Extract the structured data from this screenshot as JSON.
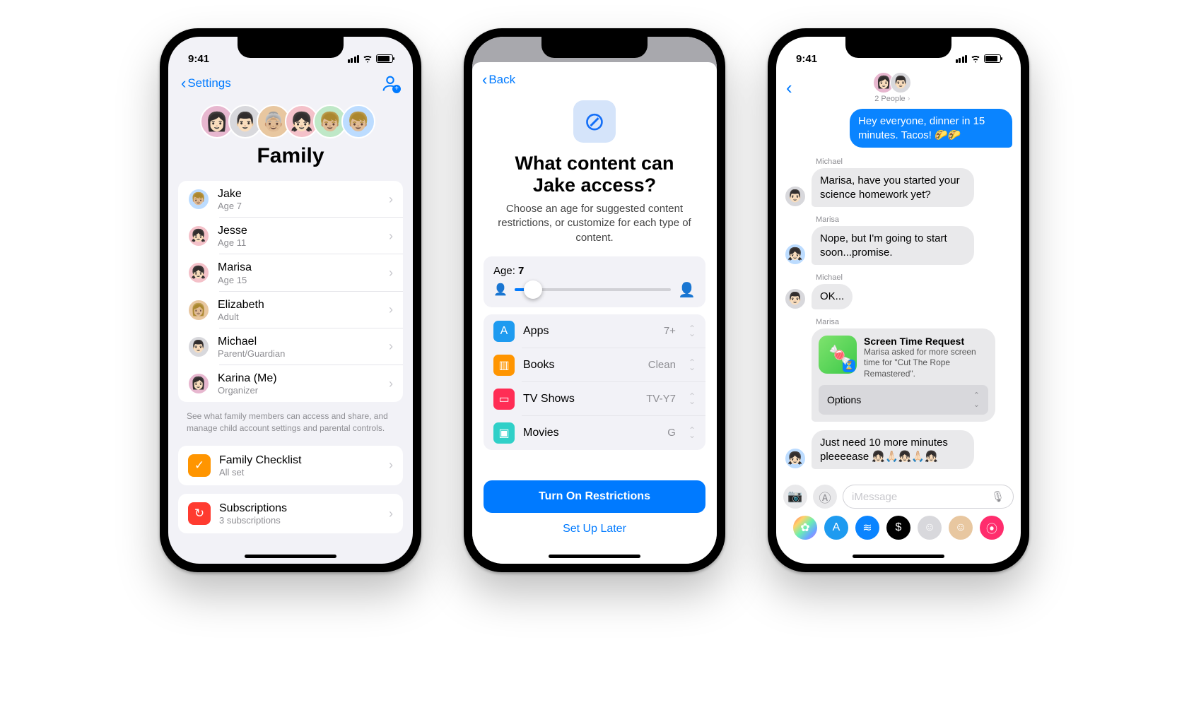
{
  "status_time": "9:41",
  "colors": {
    "accent": "#007aff",
    "outgoing": "#0a84ff",
    "gray_bg": "#f2f2f7",
    "bubble_in": "#e9e9eb"
  },
  "phone1": {
    "back_label": "Settings",
    "title": "Family",
    "avatars": [
      {
        "bg": "#e7b7cf"
      },
      {
        "bg": "#d8d8dc"
      },
      {
        "bg": "#e8c7a0"
      },
      {
        "bg": "#f4c1c9"
      },
      {
        "bg": "#bfe8c7"
      },
      {
        "bg": "#bcdcff"
      }
    ],
    "members": [
      {
        "name": "Jake",
        "sub": "Age 7",
        "bg": "#bcdcff"
      },
      {
        "name": "Jesse",
        "sub": "Age 11",
        "bg": "#f4c1c9"
      },
      {
        "name": "Marisa",
        "sub": "Age 15",
        "bg": "#f4c1c9"
      },
      {
        "name": "Elizabeth",
        "sub": "Adult",
        "bg": "#e8c7a0"
      },
      {
        "name": "Michael",
        "sub": "Parent/Guardian",
        "bg": "#d8d8dc"
      },
      {
        "name": "Karina (Me)",
        "sub": "Organizer",
        "bg": "#e7b7cf"
      }
    ],
    "hint": "See what family members can access and share, and manage child account settings and parental controls.",
    "checklist": {
      "title": "Family Checklist",
      "sub": "All set",
      "icon_bg": "#ff9500",
      "icon": "✓"
    },
    "subscriptions": {
      "title": "Subscriptions",
      "sub": "3 subscriptions",
      "icon_bg": "#ff3b30",
      "icon": "↻"
    }
  },
  "phone2": {
    "back_label": "Back",
    "title": "What content can Jake access?",
    "subtitle": "Choose an age for suggested content restrictions, or customize for each type of content.",
    "age_label": "Age:",
    "age_value": "7",
    "categories": [
      {
        "label": "Apps",
        "value": "7+",
        "bg": "#1e9bf0",
        "icon": "A"
      },
      {
        "label": "Books",
        "value": "Clean",
        "bg": "#ff9500",
        "icon": "▥"
      },
      {
        "label": "TV Shows",
        "value": "TV-Y7",
        "bg": "#ff2d55",
        "icon": "▭"
      },
      {
        "label": "Movies",
        "value": "G",
        "bg": "#30d0c8",
        "icon": "▣"
      }
    ],
    "primary": "Turn On Restrictions",
    "secondary": "Set Up Later"
  },
  "phone3": {
    "header_sub": "2 People",
    "outgoing": "Hey everyone, dinner in 15 minutes. Tacos! 🌮🌮",
    "messages": [
      {
        "sender": "Michael",
        "text": "Marisa, have you started your science homework yet?",
        "bg": "#d8d8dc",
        "show_avatar": true
      },
      {
        "sender": "Marisa",
        "text": "Nope, but I'm going to start soon...promise.",
        "bg": "#bcdcff",
        "show_avatar": true
      },
      {
        "sender": "Michael",
        "text": "OK...",
        "bg": "#d8d8dc",
        "show_avatar": true
      }
    ],
    "request": {
      "sender": "Marisa",
      "title": "Screen Time Request",
      "body": "Marisa asked for more screen time for \"Cut The Rope Remastered\".",
      "options_label": "Options"
    },
    "follow_up": {
      "sender": "Marisa",
      "text": "Just need 10 more minutes pleeeease 👧🏻🙏🏻👧🏻🙏🏻👧🏻",
      "bg": "#bcdcff"
    },
    "composer_placeholder": "iMessage",
    "tray": [
      {
        "name": "photos-icon",
        "bg": "linear-gradient(135deg,#ff6a6a,#ffd36a,#6af0b0,#6aa9ff,#c36aff)",
        "glyph": "✿"
      },
      {
        "name": "appstore-icon",
        "bg": "#1e9bf0",
        "glyph": "A"
      },
      {
        "name": "audio-icon",
        "bg": "#0a84ff",
        "glyph": "≋"
      },
      {
        "name": "cash-icon",
        "bg": "#000",
        "glyph": "$"
      },
      {
        "name": "memoji-icon",
        "bg": "#d8d8dc",
        "glyph": "☺"
      },
      {
        "name": "memoji2-icon",
        "bg": "#e8c7a0",
        "glyph": "☺"
      },
      {
        "name": "search-icon",
        "bg": "#ff2d6d",
        "glyph": "⦿"
      }
    ]
  }
}
